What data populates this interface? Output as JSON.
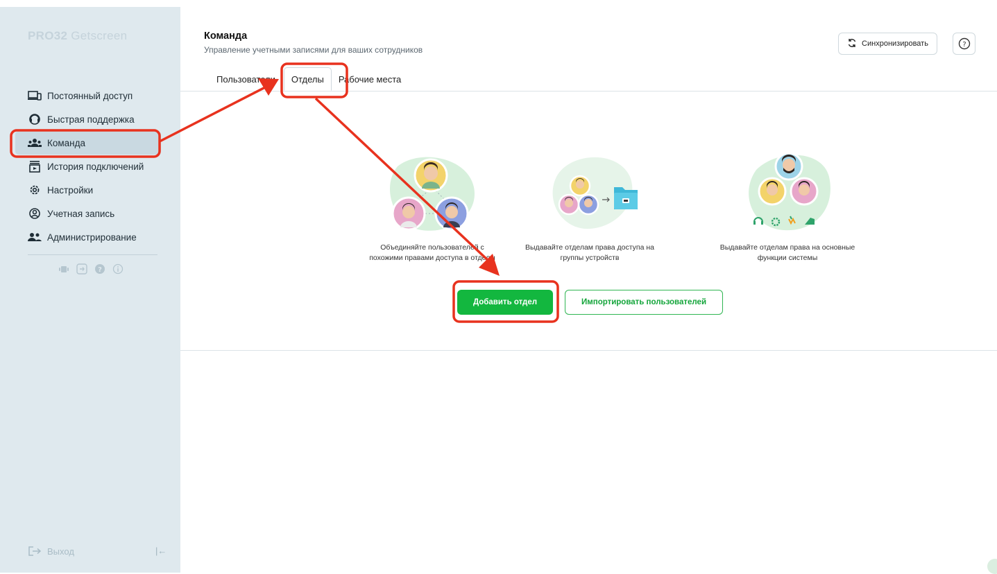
{
  "sidebar": {
    "logo_brand": "PRO32",
    "logo_product": "Getscreen",
    "items": [
      {
        "label": "Постоянный доступ",
        "icon": "devices-icon"
      },
      {
        "label": "Быстрая поддержка",
        "icon": "headset-icon"
      },
      {
        "label": "Команда",
        "icon": "team-icon"
      },
      {
        "label": "История подключений",
        "icon": "history-icon"
      },
      {
        "label": "Настройки",
        "icon": "gear-icon"
      },
      {
        "label": "Учетная запись",
        "icon": "account-icon"
      },
      {
        "label": "Администрирование",
        "icon": "admin-icon"
      }
    ],
    "active_index": 2,
    "tools": [
      "android-icon",
      "windows-icon",
      "help-circle-icon",
      "info-icon"
    ],
    "logout_label": "Выход",
    "collapse_glyph": "|←"
  },
  "header": {
    "title": "Команда",
    "subtitle": "Управление учетными записями для ваших сотрудников",
    "sync_label": "Синхронизировать",
    "help_glyph": "?"
  },
  "tabs": [
    {
      "label": "Пользователи"
    },
    {
      "label": "Отделы",
      "active": true
    },
    {
      "label": "Рабочие места"
    }
  ],
  "features": [
    {
      "caption_line1": "Объединяйте пользователей с",
      "caption_line2": "похожими правами доступа в отделы"
    },
    {
      "caption_line1": "Выдавайте отделам права доступа на",
      "caption_line2": "группы устройств"
    },
    {
      "caption_line1": "Выдавайте отделам права на основные",
      "caption_line2": "функции системы"
    }
  ],
  "actions": {
    "add_department": "Добавить отдел",
    "import_users": "Импортировать пользователей"
  },
  "colors": {
    "sidebar_bg": "#dfe9ee",
    "accent_green": "#13b73f",
    "annotation_red": "#e8321e",
    "illustration_green": "#d7f0dc"
  }
}
